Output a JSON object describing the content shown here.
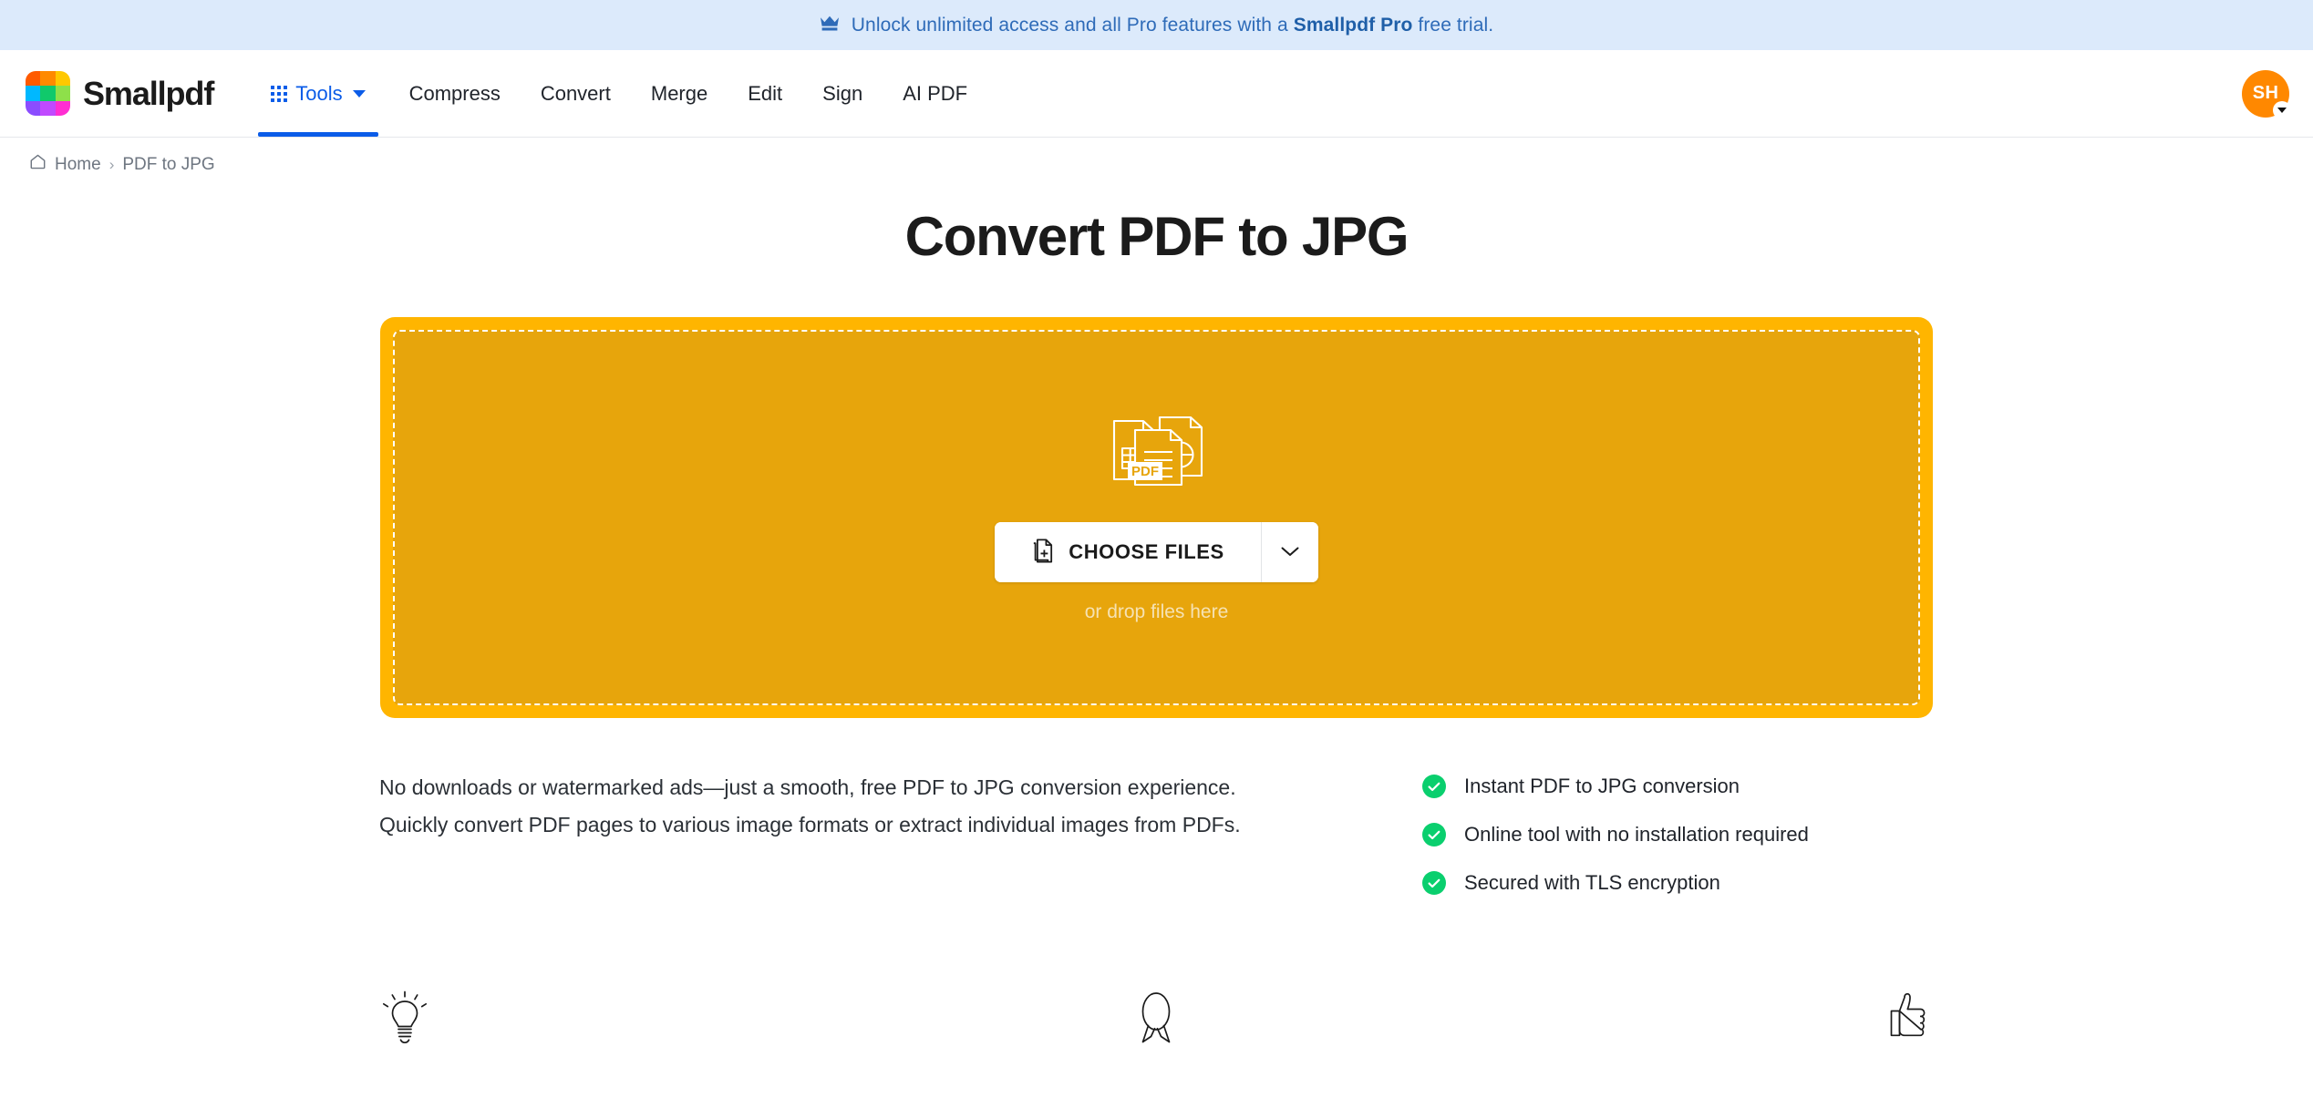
{
  "promo": {
    "icon": "crown-icon",
    "text_before": "Unlock unlimited access and all Pro features with a ",
    "brand": "Smallpdf Pro",
    "text_after": " free trial.",
    "background_color": "#DCEAFB",
    "text_color": "#2E6BB8"
  },
  "header": {
    "brand_name": "Smallpdf",
    "logo_colors": [
      "#FF5A00",
      "#FF8A00",
      "#FFC800",
      "#00B8FF",
      "#10C96B",
      "#8EE04A",
      "#8B4DFF",
      "#C04AFF",
      "#FF2ED2"
    ],
    "nav": [
      {
        "label": "Tools",
        "icon": "grid-icon",
        "active": true,
        "has_caret": true
      },
      {
        "label": "Compress",
        "active": false
      },
      {
        "label": "Convert",
        "active": false
      },
      {
        "label": "Merge",
        "active": false
      },
      {
        "label": "Edit",
        "active": false
      },
      {
        "label": "Sign",
        "active": false
      },
      {
        "label": "AI PDF",
        "active": false
      }
    ],
    "accent_color": "#0B5CE8",
    "avatar": {
      "initials": "SH",
      "background_color": "#FF8800",
      "caret": "chevron-down-icon"
    }
  },
  "breadcrumb": {
    "home_icon": "home-icon",
    "home_label": "Home",
    "separator": "›",
    "current": "PDF to JPG"
  },
  "main": {
    "title": "Convert PDF to JPG",
    "dropzone": {
      "outer_color": "#FFB500",
      "inner_color": "#E7A50C",
      "illustration": "pdf-documents-icon",
      "illustration_badge": "PDF",
      "choose_files_label": "CHOOSE FILES",
      "choose_files_icon": "file-add-icon",
      "dropdown_icon": "chevron-down-icon",
      "drop_hint": "or drop files here"
    },
    "description": "No downloads or watermarked ads—just a smooth, free PDF to JPG conversion experience. Quickly convert PDF pages to various image formats or extract individual images from PDFs.",
    "features": [
      {
        "label": "Instant PDF to JPG conversion",
        "icon": "check-circle-icon"
      },
      {
        "label": "Online tool with no installation required",
        "icon": "check-circle-icon"
      },
      {
        "label": "Secured with TLS encryption",
        "icon": "check-circle-icon"
      }
    ],
    "feature_check_color": "#0ACF6E"
  },
  "bottom_icons": [
    {
      "name": "lightbulb-icon"
    },
    {
      "name": "award-ribbon-icon"
    },
    {
      "name": "thumbs-up-icon"
    }
  ]
}
